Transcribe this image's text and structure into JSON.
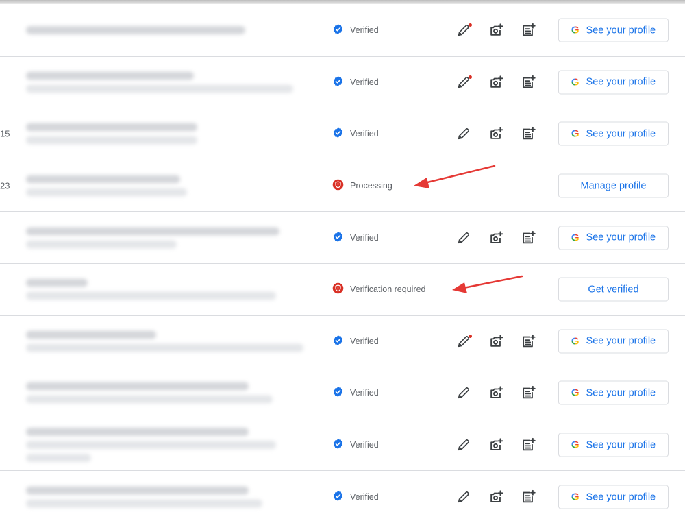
{
  "colors": {
    "verified": "#1a73e8",
    "alert": "#d93025",
    "link": "#1a73e8",
    "annotation_arrow": "#e53935"
  },
  "icons": {
    "verified": "verified-badge-icon",
    "alert": "shield-alert-icon",
    "edit": "pencil-icon",
    "photo": "add-photo-icon",
    "post": "add-post-icon",
    "google": "google-g-icon"
  },
  "google_letter": "G",
  "rows": [
    {
      "index": "",
      "status": "Verified",
      "status_type": "verified",
      "edit_dot": true,
      "show_actions": true,
      "button_label": "See your profile",
      "button_google": true
    },
    {
      "index": "",
      "status": "Verified",
      "status_type": "verified",
      "edit_dot": true,
      "show_actions": true,
      "button_label": "See your profile",
      "button_google": true
    },
    {
      "index": "15",
      "status": "Verified",
      "status_type": "verified",
      "edit_dot": false,
      "show_actions": true,
      "button_label": "See your profile",
      "button_google": true
    },
    {
      "index": "23",
      "status": "Processing",
      "status_type": "alert",
      "edit_dot": false,
      "show_actions": false,
      "button_label": "Manage profile",
      "button_google": false
    },
    {
      "index": "",
      "status": "Verified",
      "status_type": "verified",
      "edit_dot": false,
      "show_actions": true,
      "button_label": "See your profile",
      "button_google": true
    },
    {
      "index": "",
      "status": "Verification required",
      "status_type": "alert",
      "edit_dot": false,
      "show_actions": false,
      "button_label": "Get verified",
      "button_google": false
    },
    {
      "index": "",
      "status": "Verified",
      "status_type": "verified",
      "edit_dot": true,
      "show_actions": true,
      "button_label": "See your profile",
      "button_google": true
    },
    {
      "index": "",
      "status": "Verified",
      "status_type": "verified",
      "edit_dot": false,
      "show_actions": true,
      "button_label": "See your profile",
      "button_google": true
    },
    {
      "index": "",
      "status": "Verified",
      "status_type": "verified",
      "edit_dot": false,
      "show_actions": true,
      "button_label": "See your profile",
      "button_google": true
    },
    {
      "index": "",
      "status": "Verified",
      "status_type": "verified",
      "edit_dot": false,
      "show_actions": true,
      "button_label": "See your profile",
      "button_google": true
    }
  ]
}
